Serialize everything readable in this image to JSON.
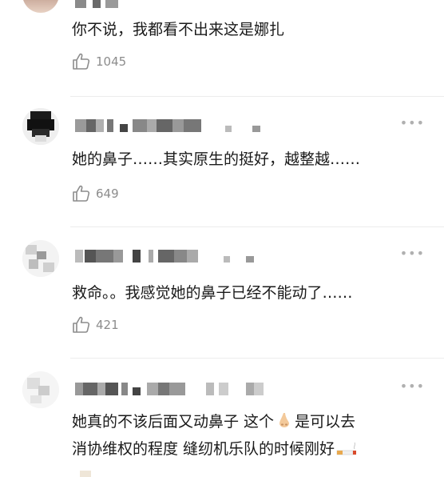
{
  "comments": [
    {
      "text": "你不说，我都看不出来这是娜扎",
      "likes": "1045"
    },
    {
      "text": "她的鼻子……其实原生的挺好，越整越……",
      "likes": "649",
      "more_label": "•••"
    },
    {
      "text": "救命。。我感觉她的鼻子已经不能动了……",
      "likes": "421",
      "more_label": "•••"
    },
    {
      "text_line1": "她真的不该后面又动鼻子 这个",
      "text_line1_tail": "是可以去",
      "text_line2": "消协维权的程度 缝纫机乐队的时候刚好",
      "more_label": "•••"
    }
  ],
  "icons": {
    "like": "thumbs-up-icon",
    "more": "more-icon",
    "nose_emoji": "nose-icon",
    "cigarette_emoji": "cigarette-icon"
  },
  "colors": {
    "text": "#1a1a1a",
    "secondary": "#8c8c8c",
    "divider": "#ececec"
  }
}
